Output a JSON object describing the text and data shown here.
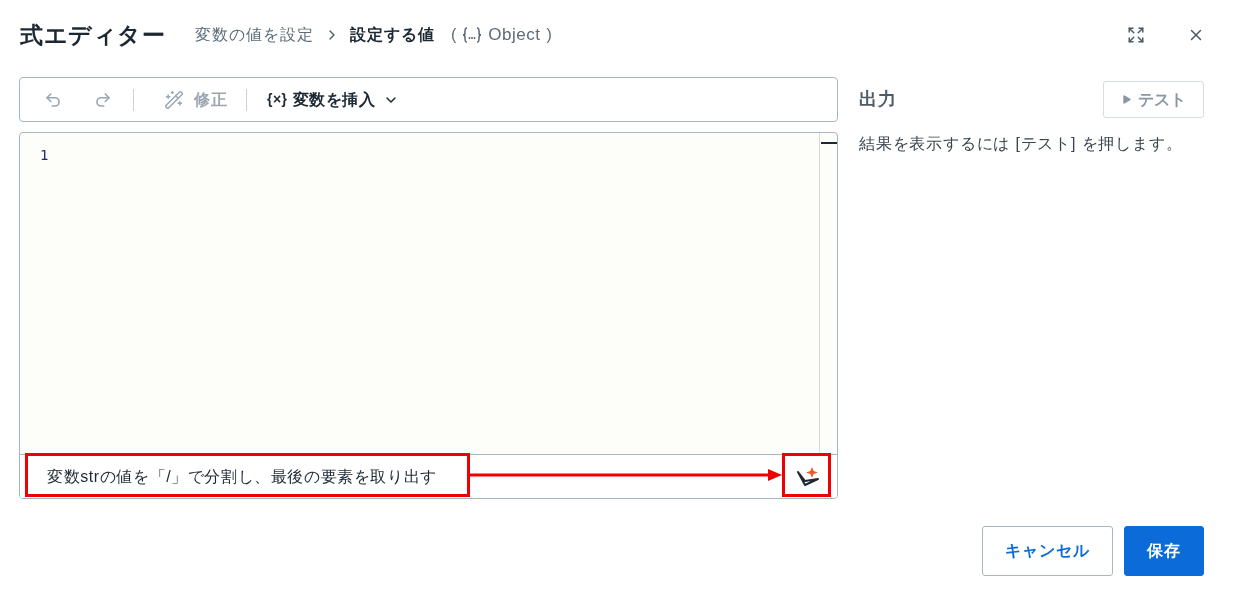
{
  "dialog": {
    "title": "式エディター",
    "breadcrumb": {
      "parent": "変数の値を設定",
      "current": "設定する値",
      "type_open": "(",
      "type": "Object",
      "type_close": ")"
    }
  },
  "toolbar": {
    "items": [
      {
        "kind": "undo",
        "disabled": true
      },
      {
        "kind": "redo",
        "disabled": true
      },
      {
        "kind": "fix",
        "label": "修正",
        "disabled": true
      },
      {
        "kind": "insert",
        "icon_text": "{×}",
        "label": "変数を挿入",
        "disabled": false
      }
    ]
  },
  "editor": {
    "line_numbers": [
      "1"
    ],
    "prompt": {
      "value": "変数strの値を「/」で分割し、最後の要素を取り出す"
    }
  },
  "output": {
    "title": "出力",
    "test_button": {
      "label": "テスト",
      "disabled": true
    },
    "hint": "結果を表示するには [テスト] を押します。"
  },
  "footer": {
    "buttons": [
      {
        "kind": "secondary",
        "label": "キャンセル"
      },
      {
        "kind": "primary",
        "label": "保存"
      }
    ]
  }
}
